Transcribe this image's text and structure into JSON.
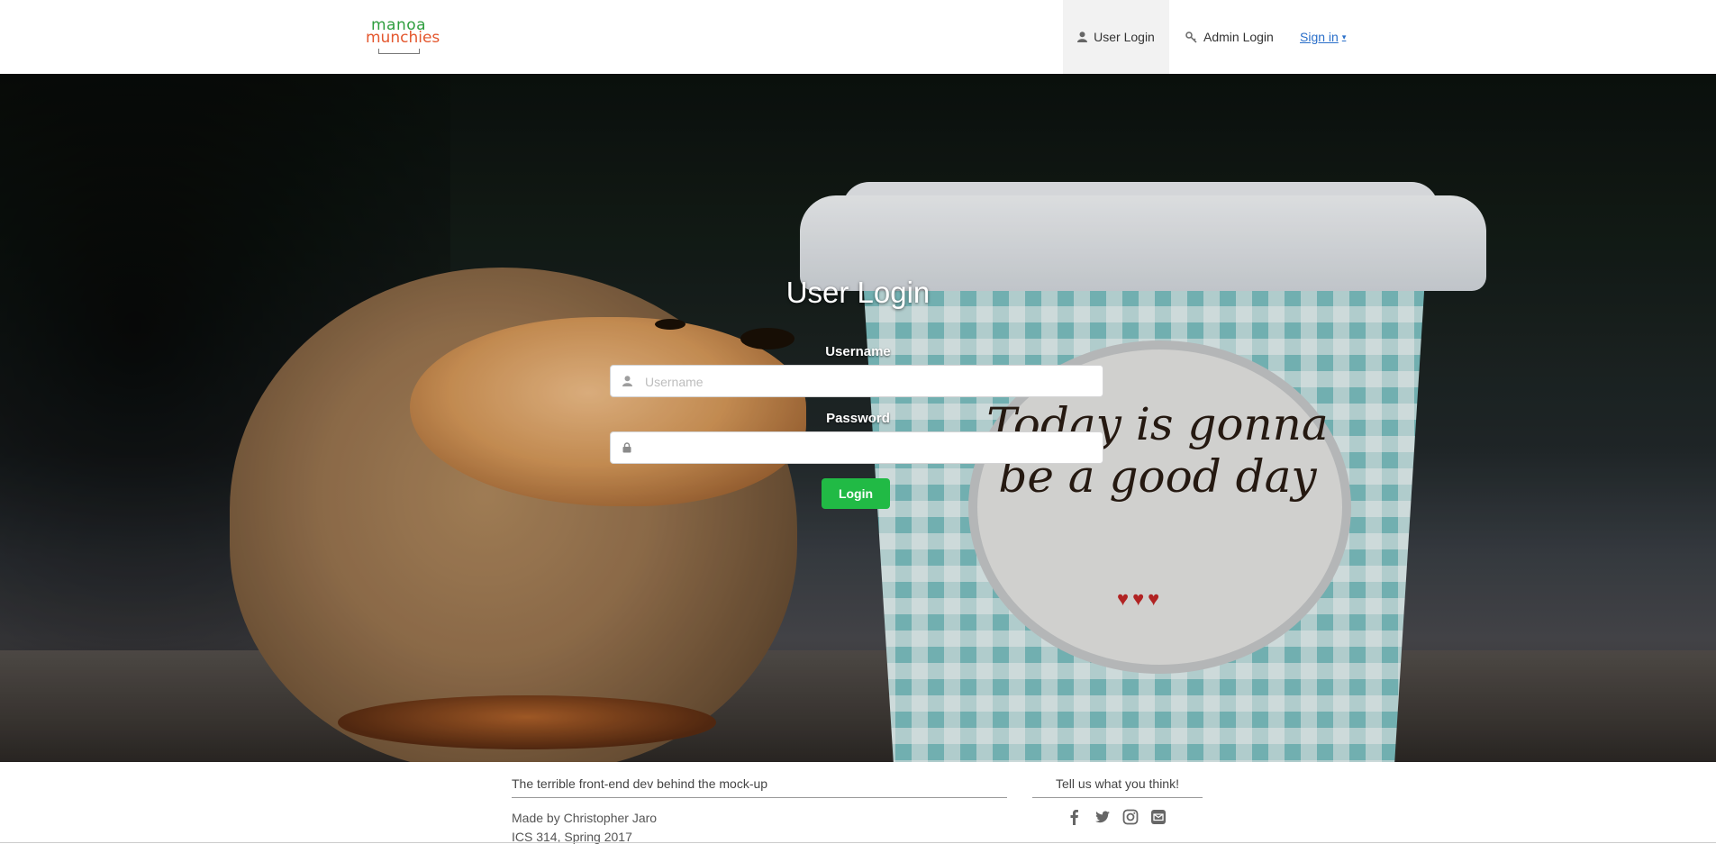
{
  "brand": {
    "line1": "manoa",
    "line2": "munchies"
  },
  "nav": {
    "user_login": "User Login",
    "admin_login": "Admin Login",
    "sign_in": "Sign in",
    "sign_in_caret": "▾",
    "active_item": "User Login",
    "icons": {
      "user_login": "user-icon",
      "admin_login": "key-icon"
    }
  },
  "hero": {
    "background_text": "Today is gonna be a good day",
    "hearts": "♥♥♥"
  },
  "login_form": {
    "title": "User Login",
    "username_label": "Username",
    "username_placeholder": "Username",
    "username_value": "",
    "password_label": "Password",
    "password_value": "",
    "submit_label": "Login",
    "icons": {
      "username": "user-icon",
      "password": "lock-icon"
    },
    "submit_color": "#21ba45"
  },
  "footer": {
    "left_heading": "The terrible front-end dev behind the mock-up",
    "made_by": "Made by Christopher Jaro",
    "course": "ICS 314, Spring 2017",
    "right_heading": "Tell us what you think!",
    "social_icons": [
      "facebook-icon",
      "twitter-icon",
      "instagram-icon",
      "mail-icon"
    ]
  }
}
